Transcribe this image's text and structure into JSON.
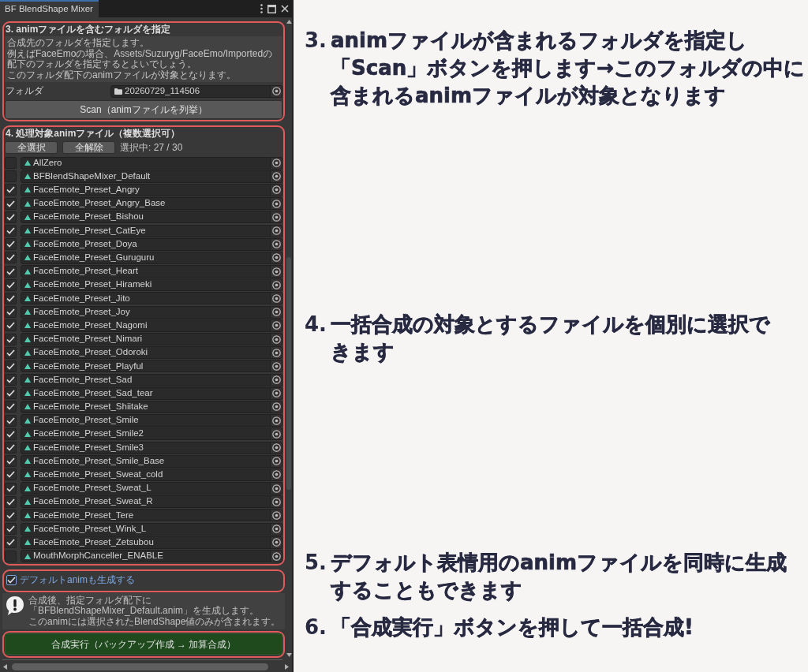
{
  "window": {
    "title": "BF BlendShape Mixer"
  },
  "folder_section": {
    "heading": "3. animファイルを含むフォルダを指定",
    "help_lines": [
      "合成先のフォルダを指定します。",
      "例えばFaceEmoの場合、Assets/Suzuryg/FaceEmo/Importedの配下のフォルダを指定するとよいでしょう。",
      "このフォルダ配下のanimファイルが対象となります。"
    ],
    "folder_field": {
      "label": "フォルダ",
      "value": "20260729_114506"
    },
    "scan_button": "Scan（animファイルを列挙）"
  },
  "file_section": {
    "heading": "4. 処理対象animファイル（複数選択可）",
    "buttons": [
      "全選択",
      "全解除"
    ],
    "selection_count": "選択中: 27 / 30",
    "files": [
      {
        "name": "AllZero",
        "checked": false
      },
      {
        "name": "BFBlendShapeMixer_Default",
        "checked": false
      },
      {
        "name": "FaceEmote_Preset_Angry",
        "checked": true
      },
      {
        "name": "FaceEmote_Preset_Angry_Base",
        "checked": true
      },
      {
        "name": "FaceEmote_Preset_Bishou",
        "checked": true
      },
      {
        "name": "FaceEmote_Preset_CatEye",
        "checked": true
      },
      {
        "name": "FaceEmote_Preset_Doya",
        "checked": true
      },
      {
        "name": "FaceEmote_Preset_Guruguru",
        "checked": true
      },
      {
        "name": "FaceEmote_Preset_Heart",
        "checked": true
      },
      {
        "name": "FaceEmote_Preset_Hirameki",
        "checked": true
      },
      {
        "name": "FaceEmote_Preset_Jito",
        "checked": true
      },
      {
        "name": "FaceEmote_Preset_Joy",
        "checked": true
      },
      {
        "name": "FaceEmote_Preset_Nagomi",
        "checked": true
      },
      {
        "name": "FaceEmote_Preset_Nimari",
        "checked": true
      },
      {
        "name": "FaceEmote_Preset_Odoroki",
        "checked": true
      },
      {
        "name": "FaceEmote_Preset_Playful",
        "checked": true
      },
      {
        "name": "FaceEmote_Preset_Sad",
        "checked": true
      },
      {
        "name": "FaceEmote_Preset_Sad_tear",
        "checked": true
      },
      {
        "name": "FaceEmote_Preset_Shiitake",
        "checked": true
      },
      {
        "name": "FaceEmote_Preset_Smile",
        "checked": true
      },
      {
        "name": "FaceEmote_Preset_Smile2",
        "checked": true
      },
      {
        "name": "FaceEmote_Preset_Smile3",
        "checked": true
      },
      {
        "name": "FaceEmote_Preset_Smile_Base",
        "checked": true
      },
      {
        "name": "FaceEmote_Preset_Sweat_cold",
        "checked": true
      },
      {
        "name": "FaceEmote_Preset_Sweat_L",
        "checked": true
      },
      {
        "name": "FaceEmote_Preset_Sweat_R",
        "checked": true
      },
      {
        "name": "FaceEmote_Preset_Tere",
        "checked": true
      },
      {
        "name": "FaceEmote_Preset_Wink_L",
        "checked": true
      },
      {
        "name": "FaceEmote_Preset_Zetsubou",
        "checked": true
      },
      {
        "name": "MouthMorphCanceller_ENABLE",
        "checked": false
      }
    ]
  },
  "default_toggle": {
    "label": "デフォルトanimも生成する",
    "checked": true
  },
  "info_box": {
    "lines": [
      "合成後、指定フォルダ配下に「BFBlendShapeMixer_Default.anim」を生成します。",
      "このanimには選択されたBlendShape値のみが含まれます。"
    ]
  },
  "run_button": "合成実行（バックアップ作成 → 加算合成）",
  "annotations": [
    {
      "number": "3.",
      "lines": [
        "animファイルが含まれるフォルダを指定し",
        "「Scan」ボタンを押します→このフォルダの中に",
        "含まれるanimファイルが対象となります"
      ]
    },
    {
      "number": "4.",
      "lines": [
        "一括合成の対象とするファイルを個別に選択で",
        "きます"
      ]
    },
    {
      "number": "5.",
      "lines": [
        "デフォルト表情用のanimファイルを同時に生成",
        "することもできます"
      ]
    },
    {
      "number": "6.",
      "lines": [
        "「合成実行」ボタンを押して一括合成!"
      ]
    }
  ]
}
